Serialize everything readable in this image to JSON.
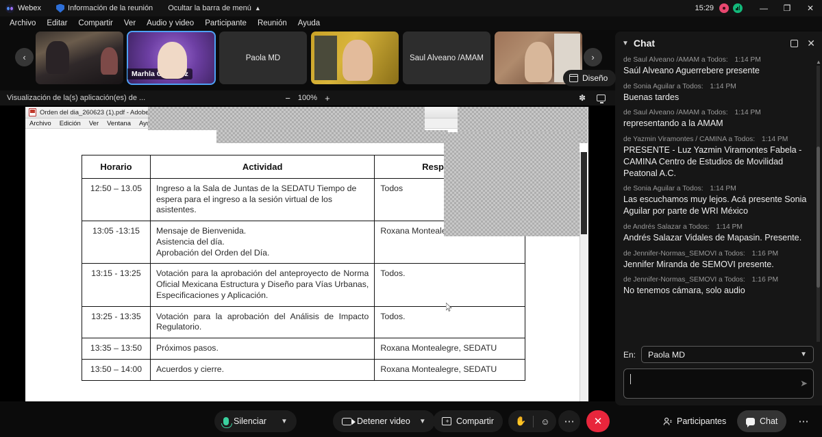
{
  "titlebar": {
    "app_name": "Webex",
    "meeting_info": "Información de la reunión",
    "hide_menubar": "Ocultar la barra de menú",
    "time": "15:29",
    "minimize": "—",
    "maximize": "❐",
    "close": "✕"
  },
  "menubar": {
    "items": [
      "Archivo",
      "Editar",
      "Compartir",
      "Ver",
      "Audio y video",
      "Participante",
      "Reunión",
      "Ayuda"
    ]
  },
  "filmstrip": {
    "prev_arrow": "‹",
    "next_arrow": "›",
    "design_badge": "Diseño",
    "tiles": [
      {
        "name": "",
        "style": "photo-room",
        "active": false,
        "label_pos": "none"
      },
      {
        "name": "Marhla Gonzalez",
        "style": "photo-purple",
        "active": true,
        "label_pos": "bottom-left"
      },
      {
        "name": "Paola MD",
        "style": "no-video",
        "active": false,
        "label_pos": "center"
      },
      {
        "name": "",
        "style": "photo-yellow",
        "active": false,
        "label_pos": "none"
      },
      {
        "name": "Saul Alveano /AMAM",
        "style": "no-video",
        "active": false,
        "label_pos": "center"
      },
      {
        "name": "",
        "style": "photo-brick",
        "active": false,
        "label_pos": "none"
      }
    ]
  },
  "sharebar": {
    "title": "Visualización de la(s) aplicación(es) de ...",
    "zoom_out": "−",
    "zoom_level": "100%",
    "zoom_in": "+",
    "annotate_icon": "annotate-icon",
    "monitor_icon": "monitor-icon"
  },
  "shared_app": {
    "window_title": "Orden del dia_260623 (1).pdf - Adobe Reader",
    "menu": [
      "Archivo",
      "Edición",
      "Ver",
      "Ventana",
      "Ayuda"
    ],
    "table": {
      "headers": [
        "Horario",
        "Actividad",
        "Responsable"
      ],
      "rows": [
        {
          "time": "12:50 – 13.05",
          "activity": "Ingreso a la Sala de Juntas de la SEDATU Tiempo de espera para el ingreso a la sesión virtual de los asistentes.",
          "responsible": "Todos"
        },
        {
          "time": "13:05 -13:15",
          "activity": "Mensaje de Bienvenida.\nAsistencia del día.\nAprobación del Orden del Día.",
          "responsible": "Roxana Montealegre, SEDATU"
        },
        {
          "time": "13:15 - 13:25",
          "activity": "Votación para la aprobación del anteproyecto de Norma Oficial Mexicana Estructura y Diseño para Vías Urbanas, Especificaciones y Aplicación.",
          "responsible": "Todos."
        },
        {
          "time": "13:25 - 13:35",
          "activity": "Votación para la aprobación del Análisis de Impacto Regulatorio.",
          "responsible": "Todos."
        },
        {
          "time": "13:35 – 13:50",
          "activity": "Próximos pasos.",
          "responsible": "Roxana Montealegre, SEDATU"
        },
        {
          "time": "13:50 – 14:00",
          "activity": "Acuerdos y cierre.",
          "responsible": "Roxana Montealegre, SEDATU"
        }
      ]
    }
  },
  "chat": {
    "title": "Chat",
    "collapse_icon": "chevron-down-icon",
    "popout_icon": "popout-icon",
    "close_icon": "close-icon",
    "messages": [
      {
        "from": "de Saul Alveano /AMAM a Todos:",
        "time": "1:14 PM",
        "text": "Saúl Alveano Aguerrebere presente"
      },
      {
        "from": "de Sonia Aguilar a Todos:",
        "time": "1:14 PM",
        "text": "Buenas tardes"
      },
      {
        "from": "de Saul Alveano /AMAM a Todos:",
        "time": "1:14 PM",
        "text": "representando a la AMAM"
      },
      {
        "from": "de Yazmin Viramontes / CAMINA a Todos:",
        "time": "1:14 PM",
        "text": "PRESENTE  - Luz Yazmin Viramontes Fabela - CAMINA Centro de Estudios de Movilidad Peatonal A.C."
      },
      {
        "from": "de Sonia Aguilar a Todos:",
        "time": "1:14 PM",
        "text": "Las escuchamos muy lejos. Acá presente Sonia Aguilar por parte de WRI México"
      },
      {
        "from": "de Andrés Salazar a Todos:",
        "time": "1:14 PM",
        "text": "Andrés Salazar Vidales de Mapasin. Presente."
      },
      {
        "from": "de Jennifer-Normas_SEMOVI a Todos:",
        "time": "1:16 PM",
        "text": "Jennifer Miranda de SEMOVI presente."
      },
      {
        "from": "de Jennifer-Normas_SEMOVI a Todos:",
        "time": "1:16 PM",
        "text": "No tenemos cámara, solo audio"
      }
    ],
    "to_label": "En:",
    "to_value": "Paola MD",
    "input_value": "",
    "input_placeholder": "",
    "send_icon": "send-icon"
  },
  "bottombar": {
    "mute_label": "Silenciar",
    "video_label": "Detener video",
    "share_label": "Compartir",
    "hand_icon": "raise-hand-icon",
    "reaction_icon": "reaction-icon",
    "more_icon": "⋯",
    "end_call_icon": "✕",
    "participants_label": "Participantes",
    "chat_label": "Chat",
    "overflow_icon": "⋯"
  },
  "colors": {
    "accent": "#4ea1f5",
    "mic_green": "#3ad29f",
    "end_call_red": "#e8263c",
    "recording_red": "#e8476f",
    "signal_green": "#13b87a"
  }
}
